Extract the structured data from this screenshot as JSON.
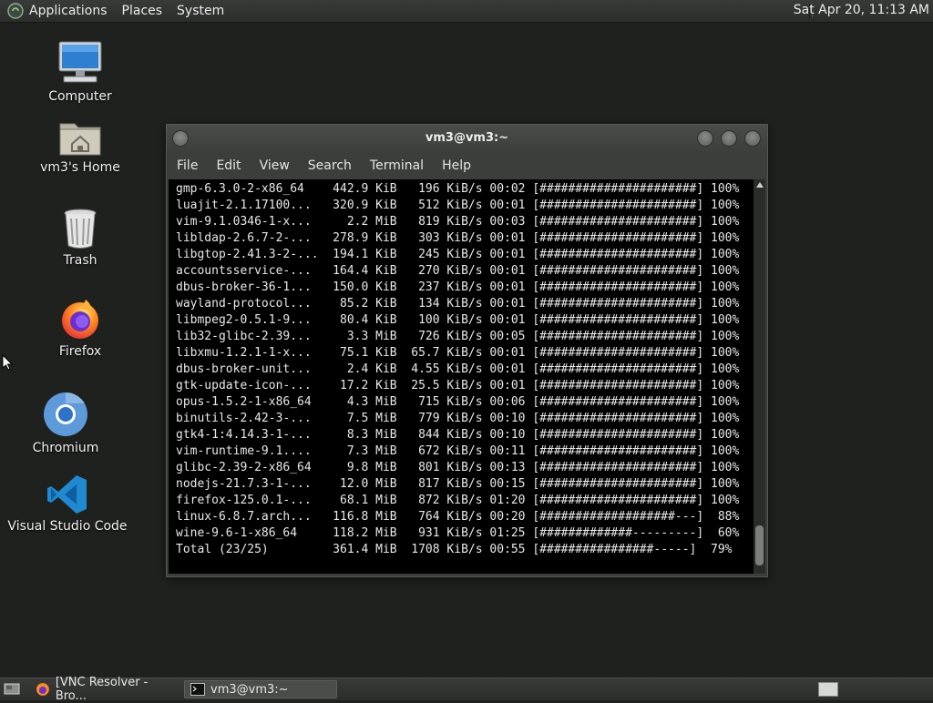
{
  "top_panel": {
    "menus": [
      "Applications",
      "Places",
      "System"
    ],
    "clock": "Sat Apr 20, 11:13 AM"
  },
  "desktop_icons": [
    {
      "label": "Computer",
      "icon": "computer-icon"
    },
    {
      "label": "vm3's Home",
      "icon": "home-folder-icon"
    },
    {
      "label": "Trash",
      "icon": "trash-icon"
    },
    {
      "label": "Firefox",
      "icon": "firefox-icon"
    },
    {
      "label": "Chromium",
      "icon": "chromium-icon"
    },
    {
      "label": "Visual Studio Code",
      "icon": "vscode-icon"
    }
  ],
  "terminal": {
    "title": "vm3@vm3:~",
    "menu": [
      "File",
      "Edit",
      "View",
      "Search",
      "Terminal",
      "Help"
    ],
    "lines": [
      "gmp-6.3.0-2-x86_64    442.9 KiB   196 KiB/s 00:02 [######################] 100%",
      "luajit-2.1.17100...   320.9 KiB   512 KiB/s 00:01 [######################] 100%",
      "vim-9.1.0346-1-x...     2.2 MiB   819 KiB/s 00:03 [######################] 100%",
      "libldap-2.6.7-2-...   278.9 KiB   303 KiB/s 00:01 [######################] 100%",
      "libgtop-2.41.3-2-...  194.1 KiB   245 KiB/s 00:01 [######################] 100%",
      "accountsservice-...   164.4 KiB   270 KiB/s 00:01 [######################] 100%",
      "dbus-broker-36-1...   150.0 KiB   237 KiB/s 00:01 [######################] 100%",
      "wayland-protocol...    85.2 KiB   134 KiB/s 00:01 [######################] 100%",
      "libmpeg2-0.5.1-9...    80.4 KiB   100 KiB/s 00:01 [######################] 100%",
      "lib32-glibc-2.39...     3.3 MiB   726 KiB/s 00:05 [######################] 100%",
      "libxmu-1.2.1-1-x...    75.1 KiB  65.7 KiB/s 00:01 [######################] 100%",
      "dbus-broker-unit...     2.4 KiB  4.55 KiB/s 00:01 [######################] 100%",
      "gtk-update-icon-...    17.2 KiB  25.5 KiB/s 00:01 [######################] 100%",
      "opus-1.5.2-1-x86_64     4.3 MiB   715 KiB/s 00:06 [######################] 100%",
      "binutils-2.42-3-...     7.5 MiB   779 KiB/s 00:10 [######################] 100%",
      "gtk4-1:4.14.3-1-...     8.3 MiB   844 KiB/s 00:10 [######################] 100%",
      "vim-runtime-9.1....     7.3 MiB   672 KiB/s 00:11 [######################] 100%",
      "glibc-2.39-2-x86_64     9.8 MiB   801 KiB/s 00:13 [######################] 100%",
      "nodejs-21.7.3-1-...    12.0 MiB   817 KiB/s 00:15 [######################] 100%",
      "firefox-125.0.1-...    68.1 MiB   872 KiB/s 01:20 [######################] 100%",
      "linux-6.8.7.arch...   116.8 MiB   764 KiB/s 00:20 [###################---]  88%",
      "wine-9.6-1-x86_64     118.2 MiB   931 KiB/s 01:25 [#############---------]  60%",
      "Total (23/25)         361.4 MiB  1708 KiB/s 00:55 [################-----]  79%"
    ]
  },
  "taskbar": {
    "tasks": [
      {
        "label": "[VNC Resolver - Bro...",
        "icon": "firefox-icon",
        "active": false
      },
      {
        "label": "vm3@vm3:~",
        "icon": "terminal-icon",
        "active": true
      }
    ]
  }
}
